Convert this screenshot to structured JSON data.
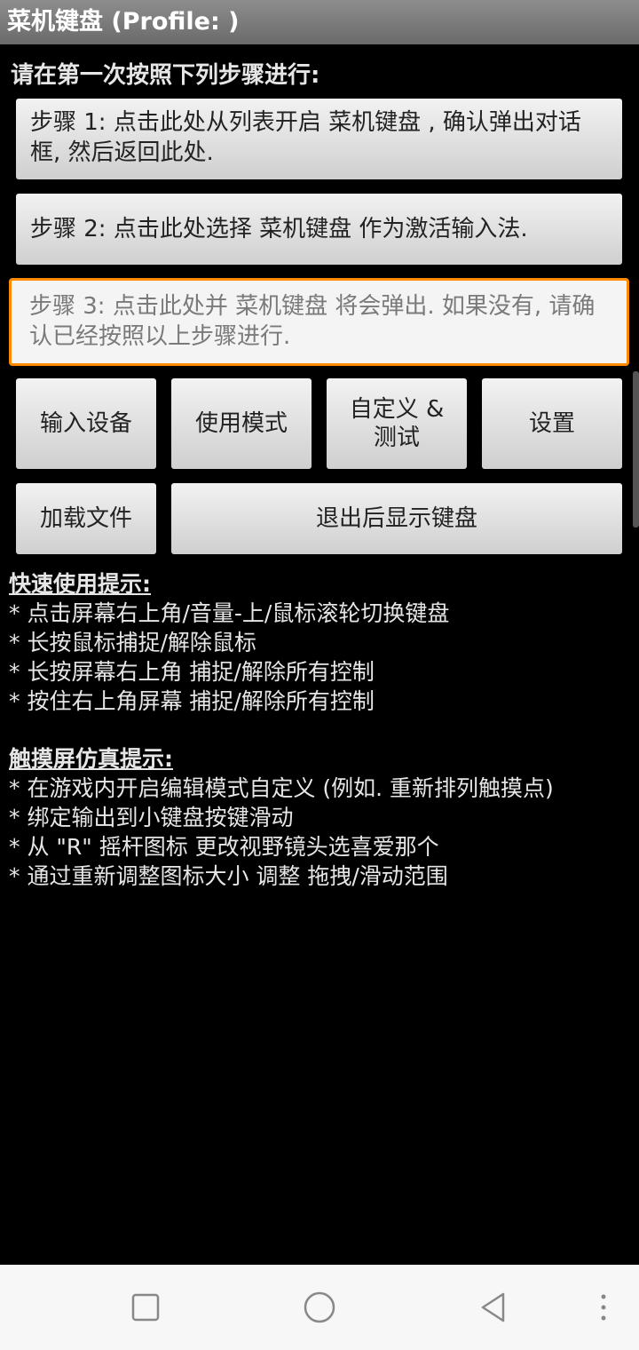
{
  "app": {
    "title": "菜机键盘 (Profile: )"
  },
  "instruction": "请在第一次按照下列步骤进行:",
  "steps": {
    "step1": "步骤 1: 点击此处从列表开启 菜机键盘 , 确认弹出对话框, 然后返回此处.",
    "step2": "步骤 2: 点击此处选择 菜机键盘 作为激活输入法.",
    "step3": "步骤 3: 点击此处并 菜机键盘 将会弹出. 如果没有, 请确认已经按照以上步骤进行."
  },
  "buttons": {
    "input_devices": "输入设备",
    "usage_mode": "使用模式",
    "customize_line1": "自定义 &",
    "customize_line2": "测试",
    "settings": "设置",
    "load_file": "加载文件",
    "show_keyboard_on_exit": "退出后显示键盘"
  },
  "quick_tips": {
    "heading": "快速使用提示:",
    "items": [
      "* 点击屏幕右上角/音量-上/鼠标滚轮切换键盘",
      "* 长按鼠标捕捉/解除鼠标",
      "* 长按屏幕右上角 捕捉/解除所有控制",
      "* 按住右上角屏幕 捕捉/解除所有控制"
    ]
  },
  "touch_tips": {
    "heading": "触摸屏仿真提示:",
    "items": [
      "* 在游戏内开启编辑模式自定义 (例如. 重新排列触摸点)",
      "* 绑定输出到小键盘按键滑动",
      "* 从 \"R\" 摇杆图标 更改视野镜头选喜爱那个",
      "* 通过重新调整图标大小 调整 拖拽/滑动范围"
    ]
  },
  "navbar": {
    "icons": [
      "recent-apps-icon",
      "home-icon",
      "back-icon",
      "more-icon"
    ]
  }
}
